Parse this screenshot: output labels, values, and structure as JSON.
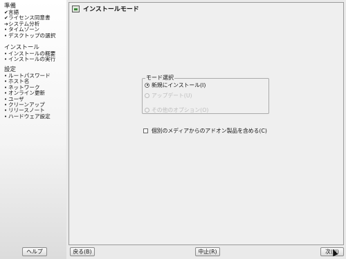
{
  "sidebar": {
    "groups": [
      {
        "title": "準備",
        "items": [
          {
            "mark": "✔",
            "label": "言語"
          },
          {
            "mark": "✔",
            "label": "ライセンス同意書"
          },
          {
            "mark": "➔",
            "label": "システム分析"
          },
          {
            "mark": "•",
            "label": "タイムゾーン"
          },
          {
            "mark": "•",
            "label": "デスクトップの選択"
          }
        ]
      },
      {
        "title": "インストール",
        "items": [
          {
            "mark": "•",
            "label": "インストールの概要"
          },
          {
            "mark": "•",
            "label": "インストールの実行"
          }
        ]
      },
      {
        "title": "設定",
        "items": [
          {
            "mark": "•",
            "label": "ルートパスワード"
          },
          {
            "mark": "•",
            "label": "ホスト名"
          },
          {
            "mark": "•",
            "label": "ネットワーク"
          },
          {
            "mark": "•",
            "label": "オンライン更新"
          },
          {
            "mark": "•",
            "label": "ユーザ"
          },
          {
            "mark": "•",
            "label": "クリーンアップ"
          },
          {
            "mark": "•",
            "label": "リリースノート"
          },
          {
            "mark": "•",
            "label": "ハードウェア設定"
          }
        ]
      }
    ]
  },
  "panel": {
    "title": "インストールモード",
    "mode_group": {
      "legend": "モード選択",
      "options": [
        {
          "label": "新規にインストール(I)",
          "checked": true,
          "disabled": false
        },
        {
          "label": "アップデート(U)",
          "checked": false,
          "disabled": true
        },
        {
          "label": "その他のオプション(O)",
          "checked": false,
          "disabled": true
        }
      ]
    },
    "addon_checkbox": {
      "label": "個別のメディアからのアドオン製品を含める(C)",
      "checked": false
    }
  },
  "buttons": {
    "help": "ヘルプ",
    "back": "戻る(B)",
    "cancel": "中止(R)",
    "next": "次(N)"
  }
}
